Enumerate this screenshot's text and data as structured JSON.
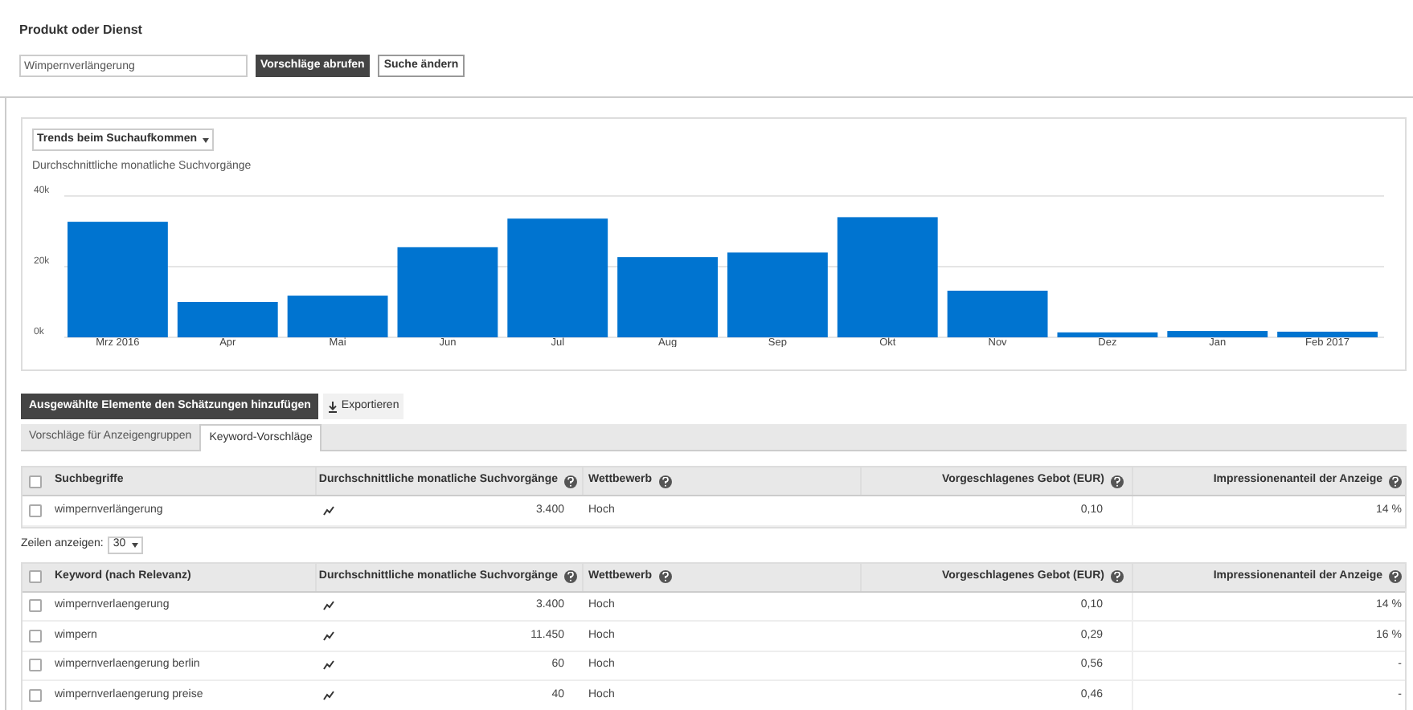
{
  "search": {
    "label": "Produkt oder Dienst",
    "value": "Wimpernverlängerung",
    "buttons": [
      "Vorschläge abrufen",
      "Suche ändern"
    ]
  },
  "chart_panel": {
    "dropdown": "Trends beim Suchaufkommen",
    "subtitle": "Durchschnittliche monatliche Suchvorgänge",
    "chart_data": {
      "type": "bar",
      "categories": [
        "Mrz 2016",
        "Apr",
        "Mai",
        "Jun",
        "Jul",
        "Aug",
        "Sep",
        "Okt",
        "Nov",
        "Dez",
        "Jan",
        "Feb 2017"
      ],
      "series": [
        {
          "color": "#0074d0",
          "values": [
            32700,
            10000,
            11800,
            25500,
            33600,
            22700,
            24000,
            34000,
            13200,
            1400,
            1800,
            1600
          ]
        }
      ],
      "ylim": [
        0,
        40000
      ],
      "yticks": [
        {
          "value": 0,
          "label": "0k"
        },
        {
          "value": 20000,
          "label": "20k"
        },
        {
          "value": 40000,
          "label": "40k"
        }
      ]
    }
  },
  "actions": {
    "add_button": "Ausgewählte Elemente den Schätzungen hinzufügen",
    "export_button": "Exportieren"
  },
  "tabs": [
    {
      "label": "Vorschläge für Anzeigengruppen",
      "selected": false
    },
    {
      "label": "Keyword-Vorschläge",
      "selected": true
    }
  ],
  "search_terms_table": {
    "all_checked": false,
    "columns": [
      "Suchbegriffe",
      "Durchschnittliche monatliche Suchvorgänge",
      "Wettbewerb",
      "Vorgeschlagenes Gebot (EUR)",
      "Impressionenanteil der Anzeige"
    ],
    "rows": [
      {
        "keyword": "wimpernverlängerung",
        "searches": "3.400",
        "competition": "Hoch",
        "bid": "0,10",
        "share": "14 %",
        "checked": false
      }
    ]
  },
  "rows_selector": {
    "label": "Zeilen anzeigen:",
    "value": "30"
  },
  "keyword_table": {
    "all_checked": false,
    "columns": [
      "Keyword (nach Relevanz)",
      "Durchschnittliche monatliche Suchvorgänge",
      "Wettbewerb",
      "Vorgeschlagenes Gebot (EUR)",
      "Impressionenanteil der Anzeige"
    ],
    "rows": [
      {
        "keyword": "wimpernverlaengerung",
        "searches": "3.400",
        "competition": "Hoch",
        "bid": "0,10",
        "share": "14 %",
        "checked": false
      },
      {
        "keyword": "wimpern",
        "searches": "11.450",
        "competition": "Hoch",
        "bid": "0,29",
        "share": "16 %",
        "checked": false
      },
      {
        "keyword": "wimpernverlaengerung berlin",
        "searches": "60",
        "competition": "Hoch",
        "bid": "0,56",
        "share": "-",
        "checked": false
      },
      {
        "keyword": "wimpernverlaengerung preise",
        "searches": "40",
        "competition": "Hoch",
        "bid": "0,46",
        "share": "-",
        "checked": false
      }
    ]
  }
}
